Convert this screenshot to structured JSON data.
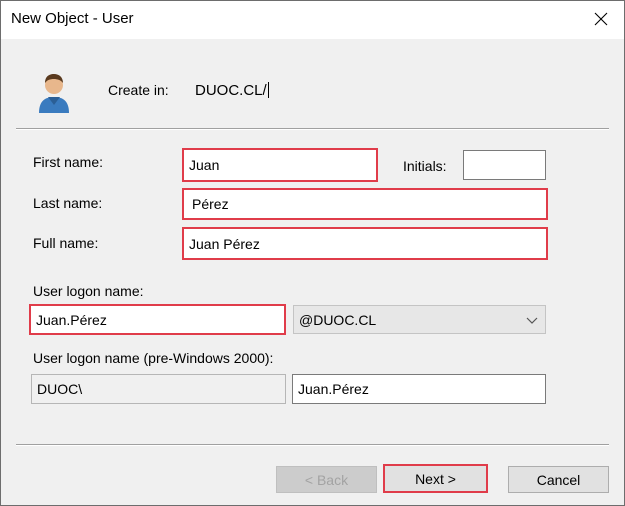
{
  "window": {
    "title": "New Object - User"
  },
  "header": {
    "icon": "user-icon",
    "create_in_label": "Create in:",
    "create_in_value": "DUOC.CL/"
  },
  "form": {
    "first_name_label": "First name:",
    "first_name_value": "Juan",
    "initials_label": "Initials:",
    "initials_value": "",
    "last_name_label": "Last name:",
    "last_name_value": "Pérez",
    "full_name_label": "Full name:",
    "full_name_value": "Juan Pérez",
    "logon_label": "User logon name:",
    "logon_value": "Juan.Pérez",
    "domain_selected": "@DUOC.CL",
    "prewin_label": "User logon name (pre-Windows 2000):",
    "prewin_domain_value": "DUOC\\",
    "prewin_user_value": "Juan.Pérez"
  },
  "buttons": {
    "back": "< Back",
    "next": "Next >",
    "cancel": "Cancel"
  },
  "colors": {
    "highlight": "#e03c4a",
    "dialog_bg": "#f0f0f0"
  }
}
